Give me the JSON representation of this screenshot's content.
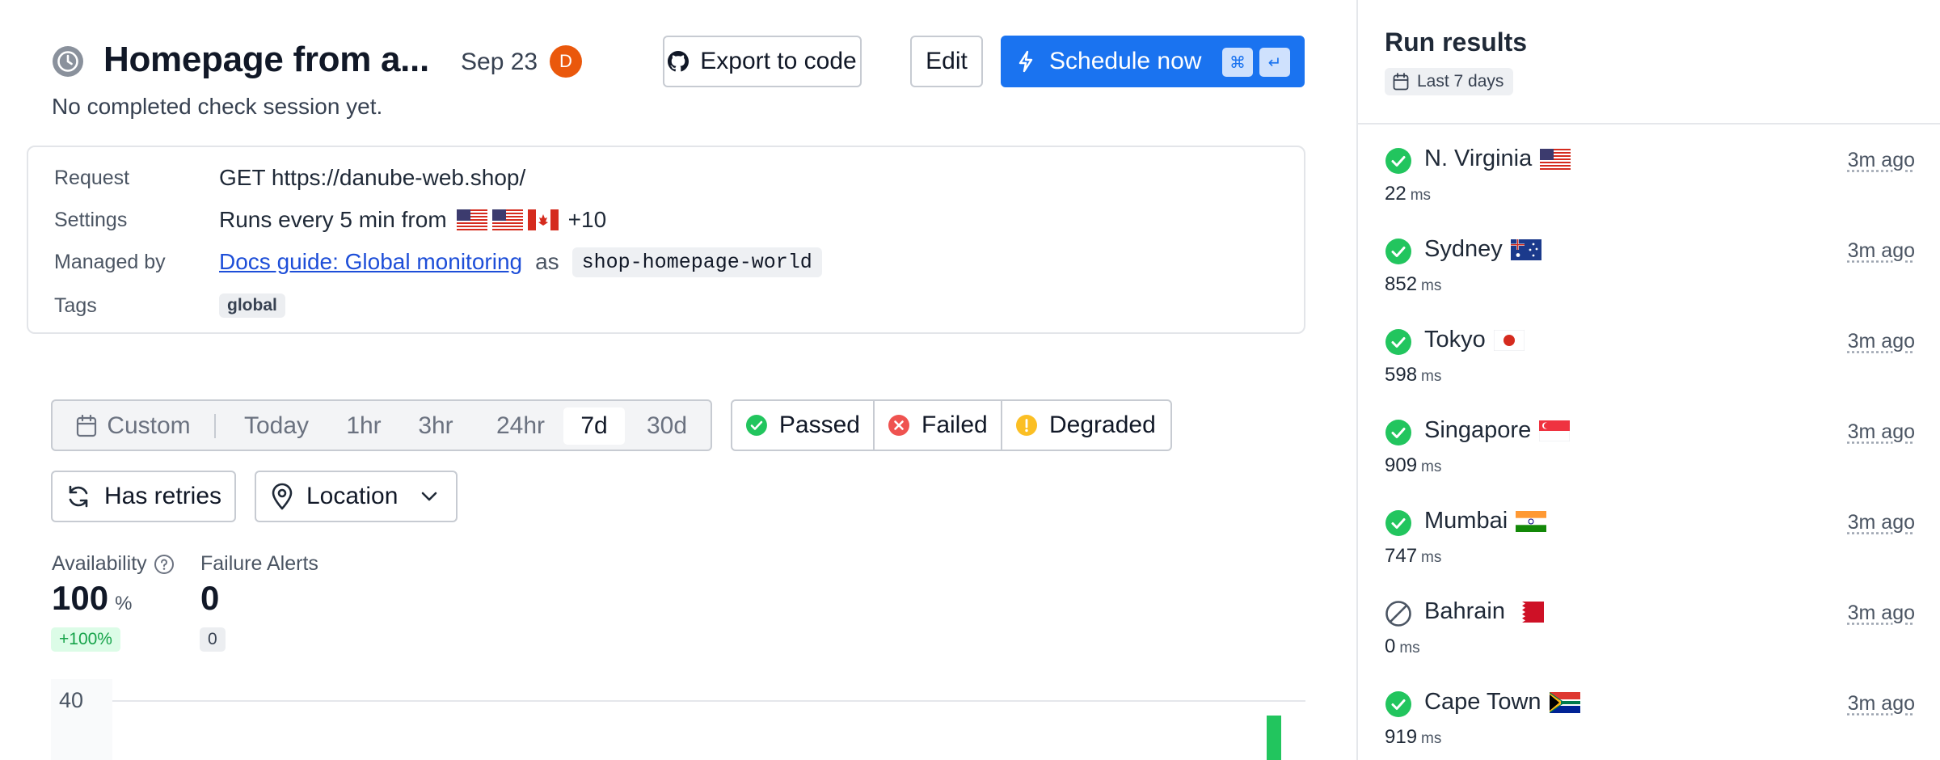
{
  "header": {
    "title": "Homepage from a...",
    "date": "Sep 23",
    "avatar_initial": "D",
    "export_label": "Export to code",
    "edit_label": "Edit",
    "schedule_label": "Schedule now",
    "shortcut_keys": [
      "⌘",
      "↵"
    ],
    "subtitle": "No completed check session yet."
  },
  "details": {
    "request_label": "Request",
    "request_value": "GET https://danube-web.shop/",
    "settings_label": "Settings",
    "settings_value": "Runs every 5 min from",
    "settings_flags": [
      "us",
      "us",
      "ca"
    ],
    "settings_more": "+10",
    "managed_label": "Managed by",
    "managed_link": "Docs guide: Global monitoring",
    "managed_as": "as",
    "managed_code": "shop-homepage-world",
    "tags_label": "Tags",
    "tags": [
      "global"
    ]
  },
  "filters": {
    "custom_label": "Custom",
    "ranges": [
      "Today",
      "1hr",
      "3hr",
      "24hr",
      "7d",
      "30d"
    ],
    "active_range": "7d",
    "statuses": [
      "Passed",
      "Failed",
      "Degraded"
    ],
    "retries_label": "Has retries",
    "location_label": "Location"
  },
  "metrics": {
    "availability_label": "Availability",
    "availability_value": "100",
    "availability_unit": "%",
    "availability_delta": "+100%",
    "alerts_label": "Failure Alerts",
    "alerts_value": "0",
    "alerts_delta": "0"
  },
  "chart_data": {
    "type": "bar",
    "y_tick_labels": [
      "40"
    ],
    "visible_bar_color": "#22c55e"
  },
  "panel": {
    "title": "Run results",
    "period": "Last 7 days",
    "runs": [
      {
        "location": "N. Virginia",
        "flag": "us",
        "status": "passed",
        "duration": "22",
        "unit": "ms",
        "time": "3m ago"
      },
      {
        "location": "Sydney",
        "flag": "au",
        "status": "passed",
        "duration": "852",
        "unit": "ms",
        "time": "3m ago"
      },
      {
        "location": "Tokyo",
        "flag": "jp",
        "status": "passed",
        "duration": "598",
        "unit": "ms",
        "time": "3m ago"
      },
      {
        "location": "Singapore",
        "flag": "sg",
        "status": "passed",
        "duration": "909",
        "unit": "ms",
        "time": "3m ago"
      },
      {
        "location": "Mumbai",
        "flag": "in",
        "status": "passed",
        "duration": "747",
        "unit": "ms",
        "time": "3m ago"
      },
      {
        "location": "Bahrain",
        "flag": "bh",
        "status": "skipped",
        "duration": "0",
        "unit": "ms",
        "time": "3m ago"
      },
      {
        "location": "Cape Town",
        "flag": "za",
        "status": "passed",
        "duration": "919",
        "unit": "ms",
        "time": "3m ago"
      }
    ]
  },
  "colors": {
    "primary": "#1a73f0",
    "passed": "#22c55e",
    "failed": "#ef5350",
    "degraded": "#fbbf24",
    "avatar": "#ea580c",
    "link": "#1d4ed8"
  }
}
